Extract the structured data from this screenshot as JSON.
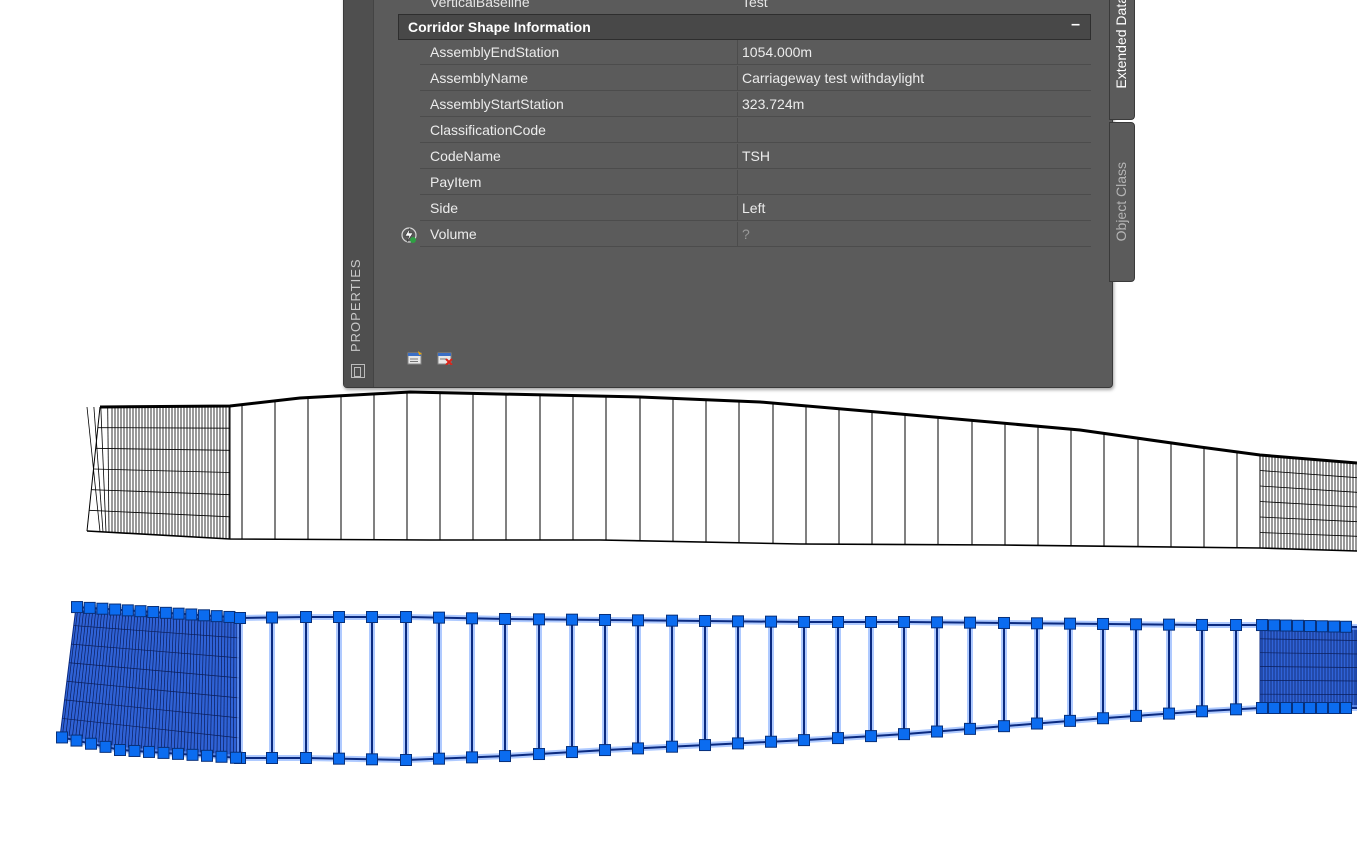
{
  "properties": {
    "palette_title": "PROPERTIES",
    "partial_row": {
      "name": "VerticalBaseline",
      "value": "Test"
    },
    "section": {
      "title": "Corridor Shape Information",
      "toggle": "–"
    },
    "rows": [
      {
        "name": "AssemblyEndStation",
        "value": "1054.000m"
      },
      {
        "name": "AssemblyName",
        "value": "Carriageway test withdaylight"
      },
      {
        "name": "AssemblyStartStation",
        "value": "323.724m"
      },
      {
        "name": "ClassificationCode",
        "value": ""
      },
      {
        "name": "CodeName",
        "value": "TSH"
      },
      {
        "name": "PayItem",
        "value": ""
      },
      {
        "name": "Side",
        "value": "Left"
      },
      {
        "name": "Volume",
        "value": "?"
      }
    ],
    "tabs": {
      "extended_data": "Extended Data",
      "object_class": "Object Class"
    }
  },
  "colors": {
    "palette_bg": "#5b5b5b",
    "section_bg": "#484848",
    "selection_blue": "#1e6fd9",
    "grip_blue": "#0b6cf0",
    "linework": "#000000"
  },
  "icons": {
    "volume_row": "lightning-check-icon",
    "tool_a": "select-objects-icon",
    "tool_b": "remove-objects-icon",
    "palette_options": "palette-options-icon"
  }
}
